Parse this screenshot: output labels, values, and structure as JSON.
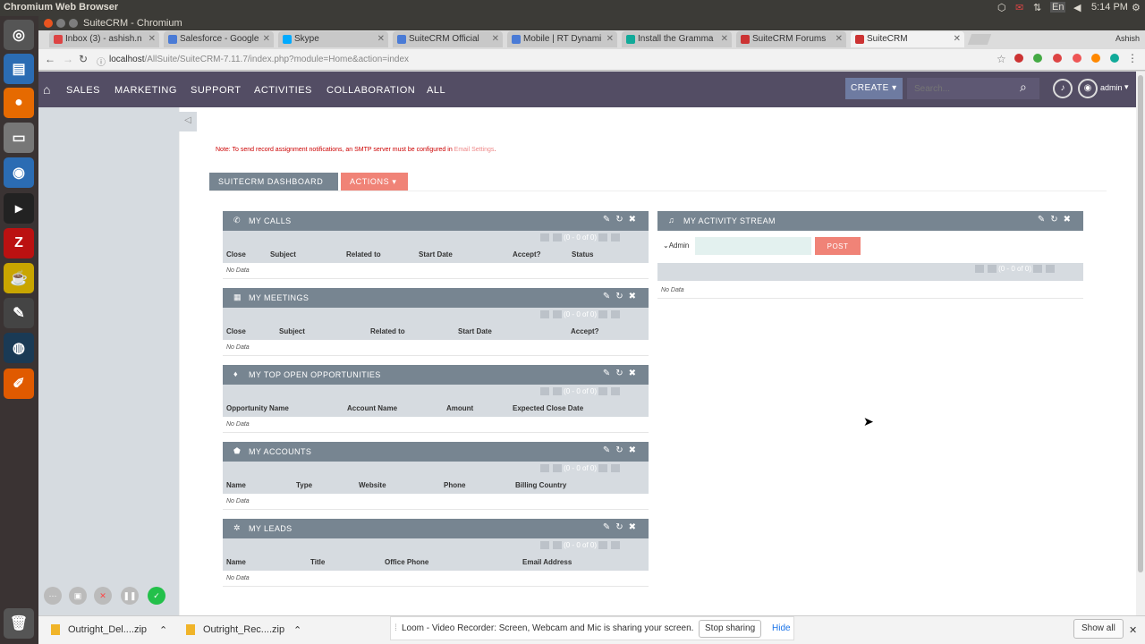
{
  "os": {
    "title": "Chromium Web Browser",
    "time": "5:14 PM",
    "user": "Ashish",
    "lang": "En"
  },
  "window": {
    "title": "SuiteCRM - Chromium"
  },
  "tabs": [
    {
      "label": "Inbox (3) - ashish.n",
      "color": "#d44"
    },
    {
      "label": "Salesforce - Google",
      "color": "#4a7bd6"
    },
    {
      "label": "Skype",
      "color": "#0af"
    },
    {
      "label": "SuiteCRM Official",
      "color": "#4a7bd6"
    },
    {
      "label": "Mobile | RT Dynami",
      "color": "#4a7bd6"
    },
    {
      "label": "Install the Gramma",
      "color": "#1a9"
    },
    {
      "label": "SuiteCRM Forums",
      "color": "#c33"
    },
    {
      "label": "SuiteCRM",
      "color": "#c33"
    }
  ],
  "address": {
    "host": "localhost",
    "path": "/AllSuite/SuiteCRM-7.11.7/index.php?module=Home&action=index"
  },
  "nav": {
    "items": [
      "SALES",
      "MARKETING",
      "SUPPORT",
      "ACTIVITIES",
      "COLLABORATION",
      "ALL"
    ],
    "create": "CREATE",
    "search_placeholder": "Search...",
    "user": "admin"
  },
  "note": {
    "text": "Note: To send record assignment notifications, an SMTP server must be configured in ",
    "link": "Email Settings",
    "end": "."
  },
  "dashboard": {
    "tab": "SUITECRM DASHBOARD",
    "actions": "ACTIONS"
  },
  "paging": "(0 - 0 of 0)",
  "nodata": "No Data",
  "dashlets": {
    "calls": {
      "title": "MY CALLS",
      "cols": [
        "Close",
        "Subject",
        "Related to",
        "Start Date",
        "Accept?",
        "Status"
      ]
    },
    "meetings": {
      "title": "MY MEETINGS",
      "cols": [
        "Close",
        "Subject",
        "Related to",
        "Start Date",
        "Accept?"
      ]
    },
    "opps": {
      "title": "MY TOP OPEN OPPORTUNITIES",
      "cols": [
        "Opportunity Name",
        "Account Name",
        "Amount",
        "Expected Close Date"
      ]
    },
    "accounts": {
      "title": "MY ACCOUNTS",
      "cols": [
        "Name",
        "Type",
        "Website",
        "Phone",
        "Billing Country"
      ]
    },
    "leads": {
      "title": "MY LEADS",
      "cols": [
        "Name",
        "Title",
        "Office Phone",
        "Email Address"
      ]
    },
    "activity": {
      "title": "MY ACTIVITY STREAM",
      "user": "Admin",
      "post": "POST"
    }
  },
  "downloads": [
    {
      "name": "Outright_Del....zip"
    },
    {
      "name": "Outright_Rec....zip"
    }
  ],
  "loom": {
    "message": "Loom - Video Recorder: Screen, Webcam and Mic is sharing your screen.",
    "stop": "Stop sharing",
    "hide": "Hide"
  },
  "showall": "Show all"
}
